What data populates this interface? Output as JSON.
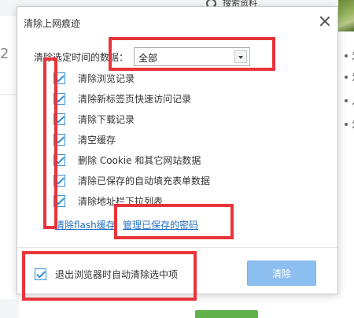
{
  "background": {
    "search_text": "搜索资料",
    "left_fragment": "2",
    "right_fragments": [
      "为",
      "为",
      "人",
      "为"
    ]
  },
  "dialog": {
    "title": "清除上网痕迹",
    "time_label": "清除选定时间的数据：",
    "time_select_value": "全部",
    "options": [
      {
        "label": "清除浏览记录",
        "checked": true
      },
      {
        "label": "清除新标签页快速访问记录",
        "checked": true
      },
      {
        "label": "清除下载记录",
        "checked": true
      },
      {
        "label": "清空缓存",
        "checked": true
      },
      {
        "label": "删除 Cookie 和其它网站数据",
        "checked": true
      },
      {
        "label": "清除已保存的自动填充表单数据",
        "checked": true
      },
      {
        "label": "清除地址栏下拉列表",
        "checked": true
      }
    ],
    "link_flash": "清除flash缓存",
    "link_passwords": "管理已保存的密码",
    "auto_clear_label": "退出浏览器时自动清除选中项",
    "auto_clear_checked": true,
    "clear_button": "清除"
  },
  "colors": {
    "annotation": "#e8343a",
    "checkbox": "#2f8fd8",
    "link": "#2470c4",
    "button": "#8cbff0"
  }
}
